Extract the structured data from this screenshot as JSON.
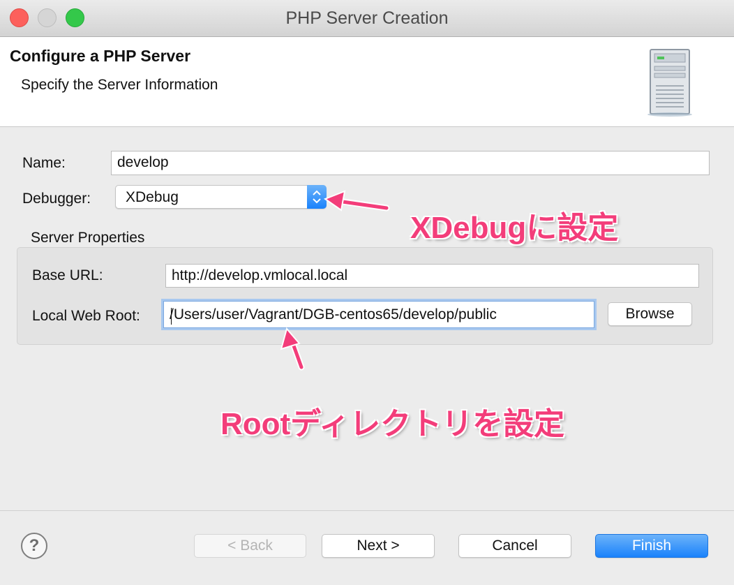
{
  "window": {
    "title": "PHP Server Creation"
  },
  "header": {
    "title": "Configure a PHP Server",
    "description": "Specify the Server Information",
    "icon": "server-icon"
  },
  "form": {
    "name_label": "Name:",
    "name_value": "develop",
    "debugger_label": "Debugger:",
    "debugger_value": "XDebug",
    "group_title": "Server Properties",
    "base_url_label": "Base URL:",
    "base_url_value": "http://develop.vmlocal.local",
    "web_root_label": "Local Web Root:",
    "web_root_value": "/Users/user/Vagrant/DGB-centos65/develop/public",
    "browse_label": "Browse"
  },
  "annotations": {
    "debugger_note": "XDebugに設定",
    "root_note": "Rootディレクトリを設定",
    "color": "#f33d7a"
  },
  "footer": {
    "help_icon": "help-icon",
    "help_glyph": "?",
    "back_label": "< Back",
    "next_label": "Next >",
    "cancel_label": "Cancel",
    "finish_label": "Finish"
  },
  "colors": {
    "accent": "#1a82fb",
    "close": "#fc605c",
    "maximize": "#34c84a"
  }
}
